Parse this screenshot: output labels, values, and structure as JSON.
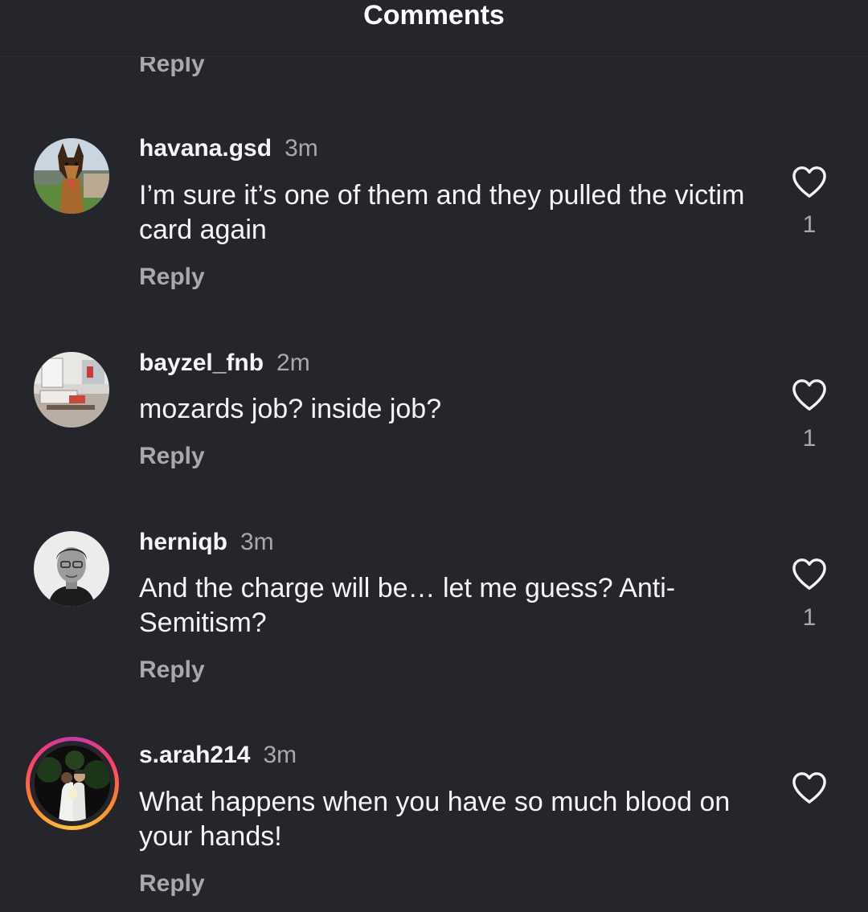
{
  "header": {
    "title": "Comments"
  },
  "top_reply_label": "Reply",
  "comments": [
    {
      "username": "havana.gsd",
      "time": "3m",
      "text": "I’m sure it’s one of them and they pulled the victim card again",
      "reply_label": "Reply",
      "likes": "1"
    },
    {
      "username": "bayzel_fnb",
      "time": "2m",
      "text": "mozards job? inside job?",
      "reply_label": "Reply",
      "likes": "1"
    },
    {
      "username": "herniqb",
      "time": "3m",
      "text": "And the charge will be… let me guess? Anti-Semitism?",
      "reply_label": "Reply",
      "likes": "1"
    },
    {
      "username": "s.arah214",
      "time": "3m",
      "text": "What happens when you have so much blood on your hands!",
      "reply_label": "Reply",
      "likes": ""
    }
  ],
  "icons": {
    "like": "heart-outline-icon",
    "story_ring": "story-ring-gradient"
  },
  "colors": {
    "background": "#25262b",
    "primary_text": "#f5f5f5",
    "secondary_text": "#a8a8ad"
  }
}
